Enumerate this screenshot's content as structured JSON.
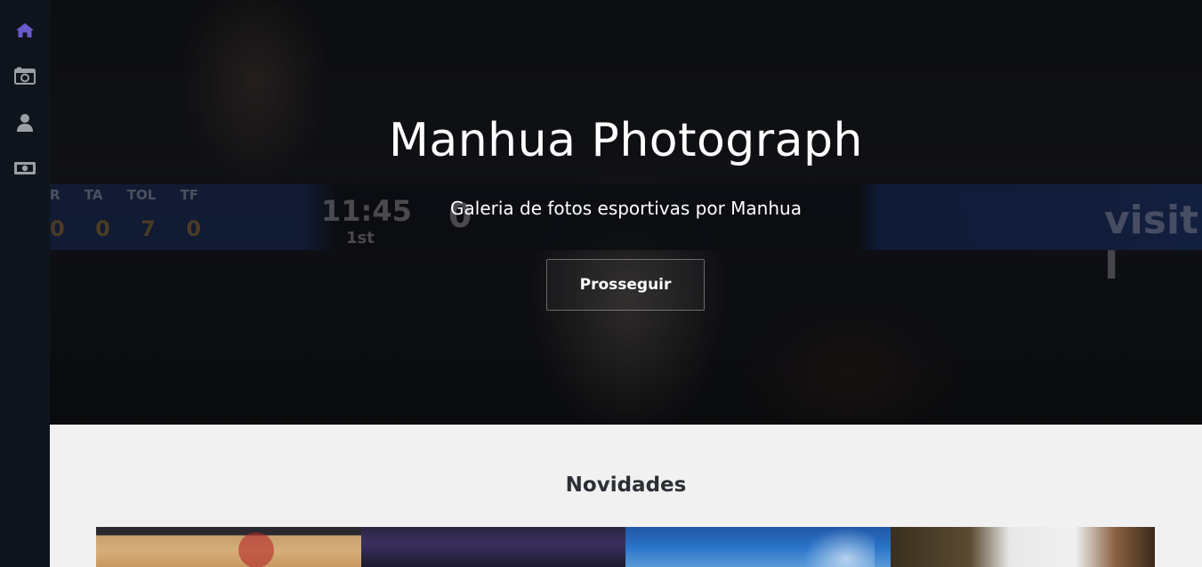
{
  "sidebar": {
    "items": [
      {
        "icon": "home-icon",
        "active": true
      },
      {
        "icon": "photo-icon",
        "active": false
      },
      {
        "icon": "user-icon",
        "active": false
      },
      {
        "icon": "money-icon",
        "active": false
      }
    ],
    "active_color": "#6a5acd",
    "icon_color": "#9aa0a6"
  },
  "hero": {
    "title": "Manhua Photograph",
    "subtitle": "Galeria de fotos esportivas por Manhua",
    "button_label": "Prosseguir",
    "scoreboard": {
      "headers": [
        "R",
        "TA",
        "TOL",
        "TF"
      ],
      "values": [
        "0",
        "0",
        "7",
        "0"
      ],
      "clock": "11:45",
      "period": "1st",
      "score": "0",
      "ad_text": "visit I"
    }
  },
  "news": {
    "title": "Novidades",
    "thumbnails": [
      {
        "alt": "basketball-all-star-photo"
      },
      {
        "alt": "crowd-photo"
      },
      {
        "alt": "surf-wave-photo"
      },
      {
        "alt": "volleyball-photo"
      }
    ]
  }
}
